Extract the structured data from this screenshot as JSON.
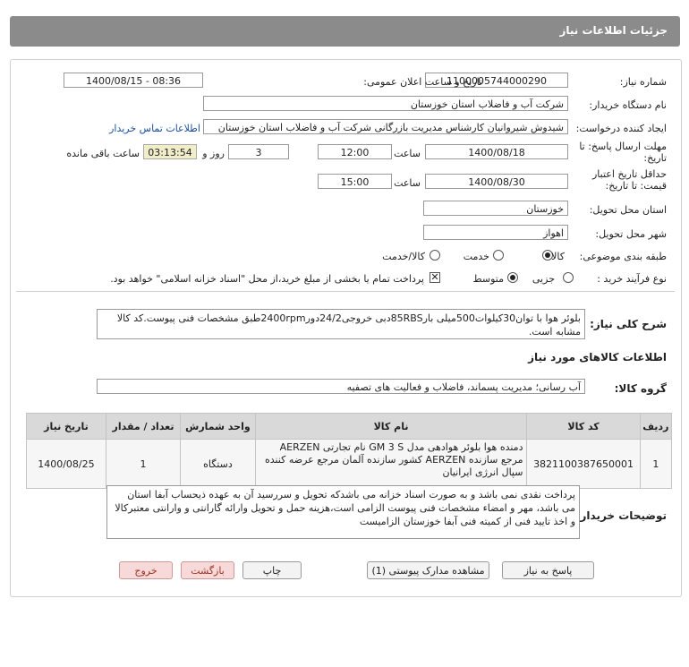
{
  "header": {
    "title": "جزئیات اطلاعات نیاز"
  },
  "form": {
    "need_number": {
      "label": "شماره نیاز:",
      "value": "1100005744000290"
    },
    "announce_datetime": {
      "label": "تاریخ و ساعت اعلان عمومی:",
      "value": "1400/08/15 - 08:36"
    },
    "buyer_org": {
      "label": "نام دستگاه خریدار:",
      "value": "شرکت آب و فاضلاب استان خوزستان"
    },
    "requester": {
      "label": "ایجاد کننده درخواست:",
      "value": "شیدوش شیروانیان کارشناس مدیریت بازرگانی شرکت آب و فاضلاب استان خوزستان",
      "contact_link": "اطلاعات تماس خریدار"
    },
    "reply_deadline": {
      "label1": "مهلت ارسال پاسخ: تا",
      "label2": "تاریخ:",
      "date": "1400/08/18",
      "time_label": "ساعت",
      "time": "12:00",
      "days": "3",
      "days_label": "روز و",
      "remaining": "03:13:54",
      "remaining_label": "ساعت باقی مانده"
    },
    "price_validity": {
      "label1": "حداقل تاریخ اعتبار",
      "label2": "قیمت: تا تاریخ:",
      "date": "1400/08/30",
      "time_label": "ساعت",
      "time": "15:00"
    },
    "delivery_province": {
      "label": "استان محل تحویل:",
      "value": "خوزستان"
    },
    "delivery_city": {
      "label": "شهر محل تحویل:",
      "value": "اهواز"
    },
    "category": {
      "label": "طبقه بندی موضوعی:",
      "opt1": "کالا",
      "opt2": "خدمت",
      "opt3": "کالا/خدمت"
    },
    "process": {
      "label": "نوع فرآیند خرید :",
      "opt1": "جزیی",
      "opt2": "متوسط",
      "note": "پرداخت تمام یا بخشی از مبلغ خرید،از محل \"اسناد خزانه اسلامی\" خواهد بود."
    },
    "general_desc": {
      "label": "شرح کلی نیاز:",
      "value": "بلوئر هوا با توان30کیلوات500میلی بار85RBSدبی خروجی24/2دور2400rpmطبق مشخصات فنی پیوست.کد کالا مشابه است."
    },
    "goods_info": {
      "label": "اطلاعات کالاهای مورد نیاز"
    },
    "goods_group": {
      "label": "گروه کالا:",
      "value": "آب رسانی؛ مدیریت پسماند، فاضلاب و فعالیت های تصفیه"
    },
    "buyer_notes": {
      "label": "توضیحات خریدار:",
      "value": "پرداخت نقدی نمی باشد و به صورت اسناد خزانه می باشدکه تحویل و سررسید آن به عهده ذیحساب آبفا استان می باشد، مهر و امضاء مشخصات فنی پیوست الزامی است،هزینه حمل و تحویل وارائه گارانتی و وارانتی معتبرکالا و اخذ تایید فنی از کمیته فنی آبفا خوزستان الزامیست"
    }
  },
  "table": {
    "headers": {
      "row": "ردیف",
      "code": "کد کالا",
      "name": "نام کالا",
      "unit": "واحد شمارش",
      "qty": "تعداد / مقدار",
      "date": "تاریخ نیاز"
    },
    "rows": [
      {
        "row": "1",
        "code": "3821100387650001",
        "name": "دمنده هوا بلوئر هوادهی مدل GM 3 S نام تجارتی AERZEN مرجع سازنده AERZEN کشور سازنده آلمان مرجع عرضه کننده سپال انرژی ایرانیان",
        "unit": "دستگاه",
        "qty": "1",
        "date": "1400/08/25"
      }
    ]
  },
  "buttons": {
    "reply": "پاسخ به نیاز",
    "attachments": "مشاهده مدارک پیوستی (1)",
    "print": "چاپ",
    "back": "بازگشت",
    "exit": "خروج"
  }
}
